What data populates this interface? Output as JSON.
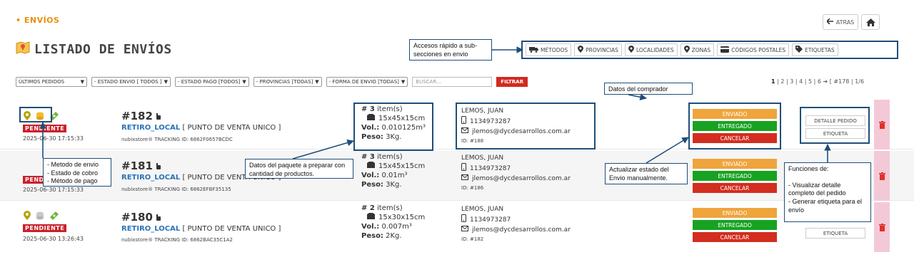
{
  "breadcrumb": "• ENVÍOS",
  "back": {
    "label": "ATRAS"
  },
  "page_title": "LISTADO DE ENVÍOS",
  "quick_access": [
    {
      "label": "MÉTODOS",
      "icon": "truck-icon"
    },
    {
      "label": "PROVINCIAS",
      "icon": "map-pin-icon"
    },
    {
      "label": "LOCALIDADES",
      "icon": "map-pin-icon"
    },
    {
      "label": "ZONAS",
      "icon": "map-pin-icon"
    },
    {
      "label": "CÓDIGOS POSTALES",
      "icon": "card-icon"
    },
    {
      "label": "ETIQUETAS",
      "icon": "tag-icon"
    }
  ],
  "callouts": {
    "quick_access": "Accesos rápido a sub-secciones en envio",
    "buyer": "Datos del comprador",
    "status_icons_1": "- Metodo de envio",
    "status_icons_2": "- Estado de cobro",
    "status_icons_3": "- Método de pago",
    "package": "Datos del paquete a preparar con cantidad de productos.",
    "update_state": "Actualizar estado del Envio manualmente.",
    "functions_title": "Funciones de:",
    "functions_1": "- Visualizar detalle completo del pedido",
    "functions_2": "- Generar etiqueta para el envío"
  },
  "filters": {
    "last_orders": "ÚLTIMOS PEDIDOS",
    "shipping_state": "- ESTADO ENVIO [ TODOS ]",
    "payment_state": "- ESTADO PAGO [TODOS]",
    "provinces": "- PROVINCIAS [TODAS]",
    "shipping_form": "- FORMA DE ENVIO [TODAS]",
    "search_placeholder": "BUSCAR...",
    "filter_btn": "FILTRAR"
  },
  "pagination": {
    "current": "1",
    "pages": "| 2 | 3 | 4 | 5 | 6",
    "arrow": "➔",
    "info": "[ #178 | 1/6"
  },
  "orders": [
    {
      "status": "PENDIENTE",
      "date": "2025-06-30 17:15:33",
      "number": "#182",
      "method": "RETIRO_LOCAL",
      "point": "[ PUNTO DE VENTA UNICO ]",
      "tracking": "nubixstore® TRACKING ID: 6862F0657BCDC",
      "items": "# 3",
      "items_label": "item(s)",
      "dims": "15x45x15cm",
      "vol_label": "Vol.:",
      "vol": "0.010125m³",
      "weight_label": "Peso:",
      "weight": "3Kg.",
      "buyer": "LEMOS, JUAN",
      "phone": "1134973287",
      "email": "jlemos@dycdesarrollos.com.ar",
      "id": "ID: #188",
      "buttons": [
        "ENVIADO",
        "ENTREGADO",
        "CANCELAR"
      ],
      "detail": "DETALLE PEDIDO",
      "label": "ETIQUETA"
    },
    {
      "status": "PENDIENTE",
      "date": "2025-06-30 17:15:33",
      "number": "#181",
      "method": "RETIRO_LOCAL",
      "point": "[ PUNTO DE VENTA UNICO ]",
      "tracking": "nubixstore® TRACKING ID: 6862EFBF35135",
      "items": "# 3",
      "items_label": "item(s)",
      "dims": "15x45x15cm",
      "vol_label": "Vol.:",
      "vol": "0.01m³",
      "weight_label": "Peso:",
      "weight": "3Kg.",
      "buyer": "LEMOS, JUAN",
      "phone": "1134973287",
      "email": "jlemos@dycdesarrollos.com.ar",
      "id": "ID: #186",
      "buttons": [
        "ENVIADO",
        "ENTREGADO",
        "CANCELAR"
      ]
    },
    {
      "status": "PENDIENTE",
      "date": "2025-06-30 13:26:43",
      "number": "#180",
      "method": "RETIRO_LOCAL",
      "point": "[ PUNTO DE VENTA UNICO ]",
      "tracking": "nubixstore® TRACKING ID: 6862BAC35C1A2",
      "items": "# 2",
      "items_label": "item(s)",
      "dims": "15x30x15cm",
      "vol_label": "Vol.:",
      "vol": "0.007m³",
      "weight_label": "Peso:",
      "weight": "2Kg.",
      "buyer": "LEMOS, JUAN",
      "phone": "1134973287",
      "email": "jlemos@dycdesarrollos.com.ar",
      "id": "ID: #182",
      "buttons": [
        "ENVIADO",
        "ENTREGADO",
        "CANCELAR"
      ],
      "label": "ETIQUETA"
    }
  ]
}
